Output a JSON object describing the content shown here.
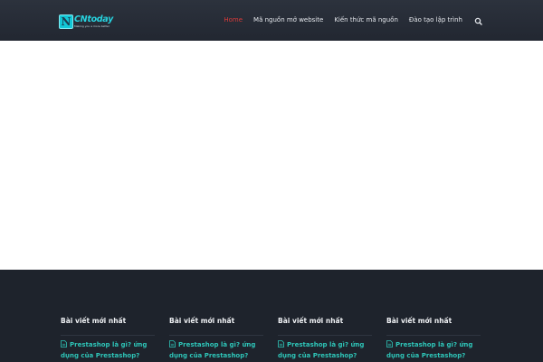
{
  "header": {
    "logo_letter": "N",
    "logo_word": "CNtoday",
    "logo_tagline": "Making you a more better",
    "nav": [
      {
        "label": "Home",
        "active": true
      },
      {
        "label": "Mã nguồn mở website",
        "active": false
      },
      {
        "label": "Kiến thức mã nguồn",
        "active": false
      },
      {
        "label": "Đào tạo lập trình",
        "active": false
      }
    ],
    "search_icon": "search-icon"
  },
  "footer": {
    "columns": [
      {
        "title": "Bài viết mới nhất",
        "link": "Prestashop là gì? ứng dụng của Prestashop?"
      },
      {
        "title": "Bài viết mới nhất",
        "link": "Prestashop là gì? ứng dụng của Prestashop?"
      },
      {
        "title": "Bài viết mới nhất",
        "link": "Prestashop là gì? ứng dụng của Prestashop?"
      },
      {
        "title": "Bài viết mới nhất",
        "link": "Prestashop là gì? ứng dụng của Prestashop?"
      }
    ],
    "link_icon": "document-icon"
  },
  "colors": {
    "header_bg": "#262b35",
    "nav_active": "#d83a3a",
    "footer_bg": "#1e232c",
    "footer_link": "#2ec5b8",
    "logo_accent": "#27d3df"
  }
}
